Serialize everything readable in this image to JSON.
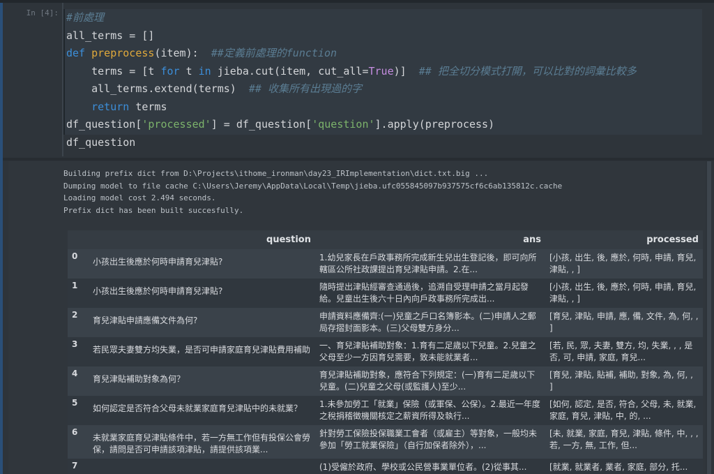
{
  "cell": {
    "prompt": "In [4]:",
    "code": [
      [
        [
          "c-com",
          "#前處理"
        ]
      ],
      [
        [
          "",
          "all_terms = []"
        ]
      ],
      [
        [
          "c-kw",
          "def "
        ],
        [
          "c-fn",
          "preprocess"
        ],
        [
          "",
          "(item):  "
        ],
        [
          "c-com",
          "##定義前處理的function"
        ]
      ],
      [
        [
          "",
          "    terms = [t "
        ],
        [
          "c-kw",
          "for"
        ],
        [
          "",
          " t "
        ],
        [
          "c-kw",
          "in"
        ],
        [
          "",
          " jieba.cut(item, cut_all="
        ],
        [
          "c-const",
          "True"
        ],
        [
          "",
          ")]  "
        ],
        [
          "c-com",
          "## 把全切分模式打開，可以比對的詞彙比較多"
        ]
      ],
      [
        [
          "",
          "    all_terms.extend(terms)  "
        ],
        [
          "c-com",
          "## 收集所有出現過的字"
        ]
      ],
      [
        [
          "",
          "    "
        ],
        [
          "c-kw",
          "return"
        ],
        [
          "",
          " terms"
        ]
      ],
      [
        [
          "",
          "df_question["
        ],
        [
          "c-str",
          "'processed'"
        ],
        [
          "",
          "] = df_question["
        ],
        [
          "c-str",
          "'question'"
        ],
        [
          "",
          "].apply(preprocess)"
        ]
      ],
      [
        [
          "",
          "df_question"
        ]
      ]
    ]
  },
  "stderr": [
    "Building prefix dict from D:\\Projects\\ithome_ironman\\day23_IRImplementation\\dict.txt.big ...",
    "Dumping model to file cache C:\\Users\\Jeremy\\AppData\\Local\\Temp\\jieba.ufc055845097b937575cf6c6ab135812c.cache",
    "Loading model cost 2.494 seconds.",
    "Prefix dict has been built succesfully."
  ],
  "dataframe": {
    "columns": [
      "",
      "question",
      "ans",
      "processed"
    ],
    "rows": [
      [
        "0",
        "小孩出生後應於何時申請育兒津貼?",
        "1.幼兒家長在戶政事務所完成新生兒出生登記後，即可向所轄區公所社政課提出育兒津貼申請。2.在...",
        "[小孩, 出生, 後, 應於, 何時, 申請, 育兒, 津貼, , ]"
      ],
      [
        "1",
        "小孩出生後應於何時申請育兒津貼?",
        "隨時提出津貼經審查通過後，追溯自受理申請之當月起發給。兒童出生後六十日內向戶政事務所完成出...",
        "[小孩, 出生, 後, 應於, 何時, 申請, 育兒, 津貼, , ]"
      ],
      [
        "2",
        "育兒津貼申請應備文件為何?",
        "申請資料應備齊:(一)兒童之戶口名簿影本。(二)申請人之郵局存摺封面影本。(三)父母雙方身分...",
        "[育兒, 津貼, 申請, 應, 備, 文件, 為, 何, , ]"
      ],
      [
        "3",
        "若民眾夫妻雙方均失業，是否可申請家庭育兒津貼費用補助",
        "一、育兒津貼補助對象：1.育有二足歲以下兒童。2.兒童之父母至少一方因育兒需要，致未能就業者...",
        "[若, 民, 眾, 夫妻, 雙方, 均, 失業, , , 是否, 可, 申請, 家庭, 育兒..."
      ],
      [
        "4",
        "育兒津貼補助對象為何？",
        "育兒津貼補助對象，應符合下列規定：(一)育有二足歲以下兒童。(二)兒童之父母(或監護人)至少...",
        "[育兒, 津貼, 貼補, 補助, 對象, 為, 何, , ]"
      ],
      [
        "5",
        "如何認定是否符合父母未就業家庭育兒津貼中的未就業？",
        "1.未參加勞工「就業」保險（或軍保、公保）。2.最近一年度之稅捐稽徵機關核定之薪資所得及執行...",
        "[如何, 認定, 是否, 符合, 父母, 未, 就業, 家庭, 育兒, 津貼, 中, 的, ..."
      ],
      [
        "6",
        "未就業家庭育兒津貼條件中，若一方無工作但有投保公會勞保，請問是否可申請該項津貼，請提供該項業...",
        "針對勞工保險投保職業工會者（或雇主）等對象，一般均未參加「勞工就業保險」（自行加保者除外），...",
        "[未, 就業, 家庭, 育兒, 津貼, 條件, 中, , , 若, 一方, 無, 工作, 但..."
      ],
      [
        "7",
        "",
        "(1)受僱於政府、學校或公民營事業單位者。(2)從事其...",
        "[就業, 就業者, 業者, 家庭, 部分, 托..."
      ]
    ]
  }
}
